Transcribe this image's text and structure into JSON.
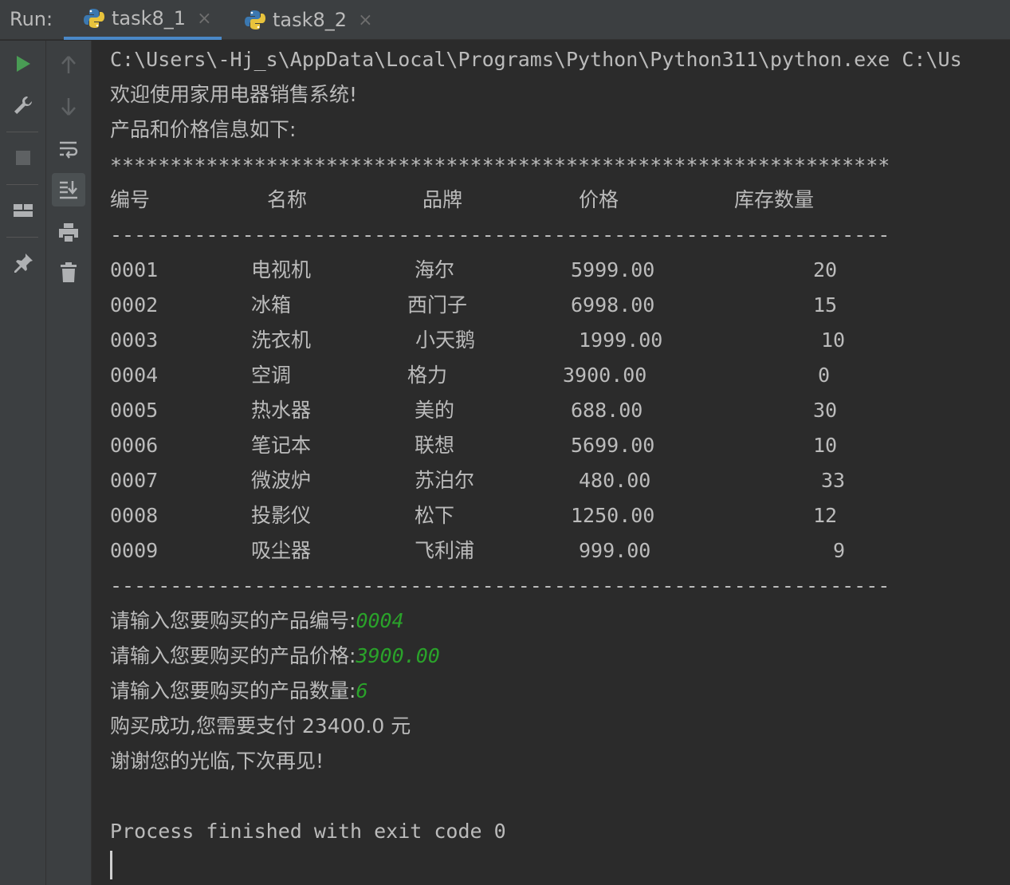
{
  "run_panel": {
    "label": "Run:",
    "tabs": [
      {
        "label": "task8_1",
        "active": true
      },
      {
        "label": "task8_2",
        "active": false
      }
    ],
    "tab_close_glyph": "×"
  },
  "toolbar": {
    "primary": [
      "rerun-icon",
      "wrench-icon",
      "stop-icon",
      "layout-icon",
      "pin-icon"
    ],
    "secondary": [
      "up-arrow-icon",
      "down-arrow-icon",
      "soft-wrap-icon",
      "scroll-to-end-icon",
      "print-icon",
      "trash-icon"
    ]
  },
  "colors": {
    "background": "#2b2b2b",
    "text": "#bbbbbb",
    "input": "#2aa22a",
    "run_green": "#499c54",
    "tab_underline": "#4a88c7"
  },
  "console": {
    "command": "C:\\Users\\-Hj_s\\AppData\\Local\\Programs\\Python\\Python311\\python.exe C:\\Us",
    "welcome": "欢迎使用家用电器销售系统!",
    "info_heading": "产品和价格信息如下:",
    "stars": "*****************************************************************",
    "table_headers": [
      "编号",
      "名称",
      "品牌",
      "价格",
      "库存数量"
    ],
    "dashes": "-----------------------------------------------------------------",
    "rows": [
      {
        "id": "0001",
        "name": "电视机",
        "brand": "海尔",
        "price": "5999.00",
        "stock": "20"
      },
      {
        "id": "0002",
        "name": "冰箱",
        "brand": "西门子",
        "price": "6998.00",
        "stock": "15"
      },
      {
        "id": "0003",
        "name": "洗衣机",
        "brand": "小天鹅",
        "price": "1999.00",
        "stock": "10"
      },
      {
        "id": "0004",
        "name": "空调",
        "brand": "格力",
        "price": "3900.00",
        "stock": "0"
      },
      {
        "id": "0005",
        "name": "热水器",
        "brand": "美的",
        "price": "688.00",
        "stock": "30"
      },
      {
        "id": "0006",
        "name": "笔记本",
        "brand": "联想",
        "price": "5699.00",
        "stock": "10"
      },
      {
        "id": "0007",
        "name": "微波炉",
        "brand": "苏泊尔",
        "price": "480.00",
        "stock": "33"
      },
      {
        "id": "0008",
        "name": "投影仪",
        "brand": "松下",
        "price": "1250.00",
        "stock": "12"
      },
      {
        "id": "0009",
        "name": "吸尘器",
        "brand": "飞利浦",
        "price": "999.00",
        "stock": "9"
      }
    ],
    "prompt_id": "请输入您要购买的产品编号:",
    "input_id": "0004",
    "prompt_price": "请输入您要购买的产品价格:",
    "input_price": "3900.00",
    "prompt_qty": "请输入您要购买的产品数量:",
    "input_qty": "6",
    "success": "购买成功,您需要支付 23400.0 元",
    "farewell": "谢谢您的光临,下次再见!",
    "exit_message": "Process finished with exit code 0"
  }
}
